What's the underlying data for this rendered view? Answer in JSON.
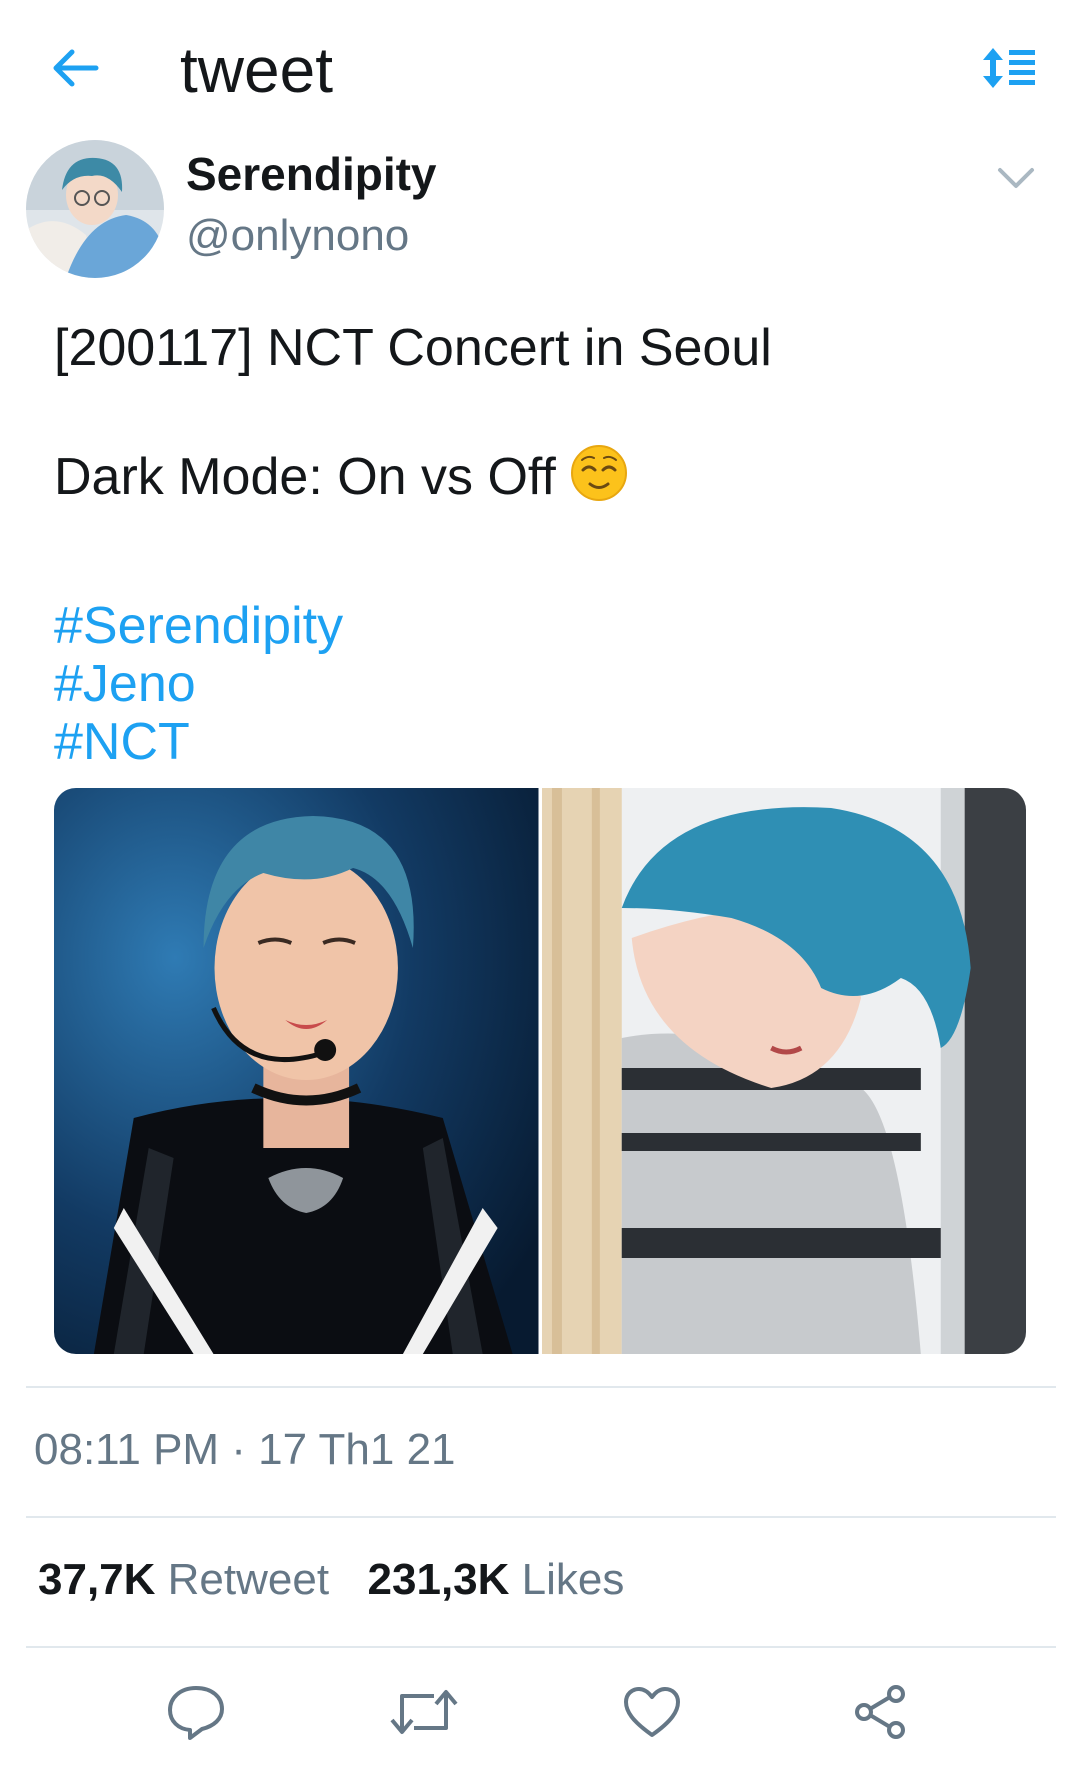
{
  "header": {
    "title": "tweet",
    "back_icon": "arrow-left-icon",
    "sort_icon": "sort-toggle-icon",
    "accent_color": "#1da1f2"
  },
  "author": {
    "display_name": "Serendipity",
    "handle": "@onlynono",
    "more_icon": "chevron-down-icon"
  },
  "tweet": {
    "lines": [
      "[200117] NCT Concert in Seoul",
      "Dark Mode: On vs Off"
    ],
    "emoji": "relieved-face-icon",
    "hashtags": [
      "#Serendipity",
      "#Jeno",
      "#NCT"
    ]
  },
  "media": {
    "photos": [
      "dark-mode-concert-photo",
      "light-mode-photo"
    ]
  },
  "meta": {
    "timestamp": "08:11 PM · 17 Th1 21"
  },
  "stats": {
    "retweets_count": "37,7K",
    "retweets_label": "Retweet",
    "likes_count": "231,3K",
    "likes_label": "Likes"
  },
  "actions": [
    {
      "icon": "reply-icon"
    },
    {
      "icon": "retweet-icon"
    },
    {
      "icon": "like-heart-icon"
    },
    {
      "icon": "share-icon"
    }
  ]
}
